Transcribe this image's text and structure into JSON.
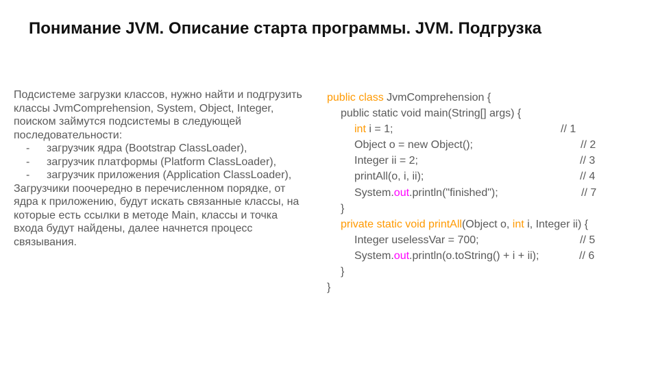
{
  "slide": {
    "title": "Понимание JVM. Описание старта программы. JVM. Подгрузка"
  },
  "description": {
    "intro": "Подсистеме загрузки классов, нужно найти и подгрузить классы JvmComprehension, System, Object, Integer, поиском займутся подсистемы в следующей последовательности:",
    "bullets": [
      "загрузчик ядра (Bootstrap ClassLoader),",
      "загрузчик  платформы (Platform ClassLoader),",
      "загрузчик  приложения (Application ClassLoader),"
    ],
    "bullet_marker": "-",
    "outro": "Загрузчики поочередно в перечисленном порядке, от ядра к приложению, будут искать связанные классы, на которые есть ссылки в методе Main, классы и точка входа будут найдены, далее начнется процесс связывания."
  },
  "code": {
    "colors": {
      "keyword": "#ff9900",
      "field": "#ff00ff",
      "text": "#595959"
    },
    "l1_kw": "public class",
    "l1_rest": " JvmComprehension {",
    "l2": "public static void main(String[] args) {",
    "l3_kw": "int",
    "l3_rest": " i = 1;",
    "l3_cmt": "// 1",
    "l4": "Object o = new Object();",
    "l4_cmt": "// 2",
    "l5": "Integer ii = 2;",
    "l5_cmt": "// 3",
    "l6": "printAll(o, i, ii);",
    "l6_cmt": "// 4",
    "l7_a": "System.",
    "l7_fld": "out",
    "l7_b": ".println(\"finished\");",
    "l7_cmt": "// 7",
    "l8": "}",
    "l9_kw": "private static void printAll",
    "l9_a": "(Object o, ",
    "l9_kw2": "int",
    "l9_b": " i, Integer ii) {",
    "l10": "Integer uselessVar = 700;",
    "l10_cmt": "// 5",
    "l11_a": "System.",
    "l11_fld": "out",
    "l11_b": ".println(o.toString() + i + ii);",
    "l11_cmt": "// 6",
    "l12": "}",
    "l13": "}"
  }
}
